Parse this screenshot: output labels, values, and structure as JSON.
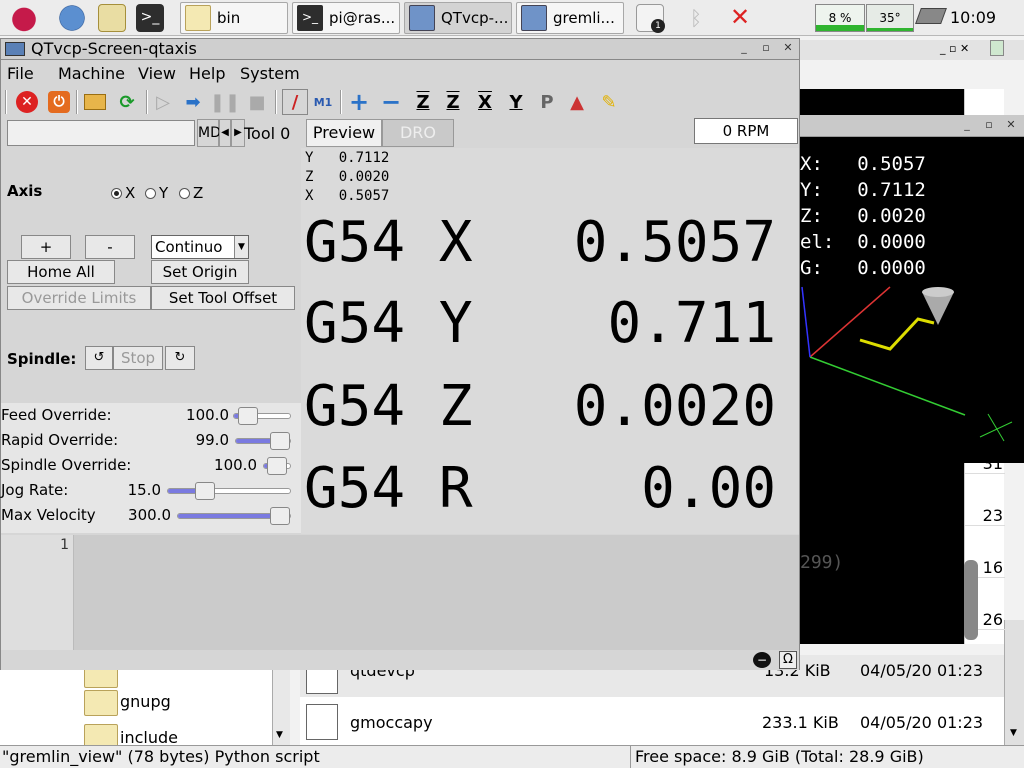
{
  "taskbar": {
    "tasks": [
      "bin",
      "pi@ras...",
      "QTvcp-...",
      "gremli..."
    ],
    "cpu": "8 %",
    "temp": "35°",
    "clock": "10:09"
  },
  "filemanager": {
    "folders": [
      "gnupg",
      "include"
    ],
    "files": [
      {
        "name": "qtdevcp",
        "size": "13.2 KiB",
        "date": "04/05/20 01:23"
      },
      {
        "name": "gmoccapy",
        "size": "233.1 KiB",
        "date": "04/05/20 01:23"
      }
    ],
    "status_left": "\"gremlin_view\" (78 bytes) Python script",
    "status_right": "Free space: 8.9 GiB (Total: 28.9 GiB)"
  },
  "terminal": {
    "fragment": "299)",
    "rows": [
      "31",
      "23",
      "16",
      "26"
    ]
  },
  "gremlin": {
    "dro": [
      {
        "label": "X:",
        "value": "0.5057"
      },
      {
        "label": "Y:",
        "value": "0.7112"
      },
      {
        "label": "Z:",
        "value": "0.0020"
      },
      {
        "label": "el:",
        "value": "0.0000"
      },
      {
        "label": "G:",
        "value": "0.0000"
      }
    ]
  },
  "qtvcp": {
    "title": "QTvcp-Screen-qtaxis",
    "menu": [
      "File",
      "Machine",
      "View",
      "Help",
      "System"
    ],
    "mdi_placeholder": "",
    "tabs": {
      "mdi": "MD",
      "tool": "Tool 0",
      "preview": "Preview",
      "dro": "DRO"
    },
    "rpm": "0 RPM",
    "axis_label": "Axis",
    "axes": [
      "X",
      "Y",
      "Z"
    ],
    "selected_axis": "X",
    "buttons": {
      "jog_plus": "+",
      "jog_minus": "-",
      "jog_mode": "Continuo",
      "home_all": "Home All",
      "set_origin": "Set Origin",
      "override_limits": "Override Limits",
      "set_tool_offset": "Set Tool Offset",
      "spindle_label": "Spindle:",
      "stop": "Stop"
    },
    "sliders": [
      {
        "label": "Feed Override:",
        "value": "100.0",
        "fraction": 0.25
      },
      {
        "label": "Rapid Override:",
        "value": "99.0",
        "fraction": 0.99
      },
      {
        "label": "Spindle Override:",
        "value": "100.0",
        "fraction": 0.5
      },
      {
        "label": "Jog Rate:",
        "value": "15.0",
        "fraction": 0.3
      },
      {
        "label": "Max Velocity",
        "value": "300.0",
        "fraction": 0.98
      }
    ],
    "dro_small": [
      {
        "axis": "Y",
        "value": "0.7112"
      },
      {
        "axis": "Z",
        "value": "0.0020"
      },
      {
        "axis": "X",
        "value": "0.5057"
      }
    ],
    "dro_big": [
      {
        "coord": "G54",
        "axis": "X",
        "value": "0.5057"
      },
      {
        "coord": "G54",
        "axis": "Y",
        "value": "0.711"
      },
      {
        "coord": "G54",
        "axis": "Z",
        "value": "0.0020"
      },
      {
        "coord": "G54",
        "axis": "R",
        "value": "0.00"
      }
    ],
    "editor_line": "1"
  }
}
